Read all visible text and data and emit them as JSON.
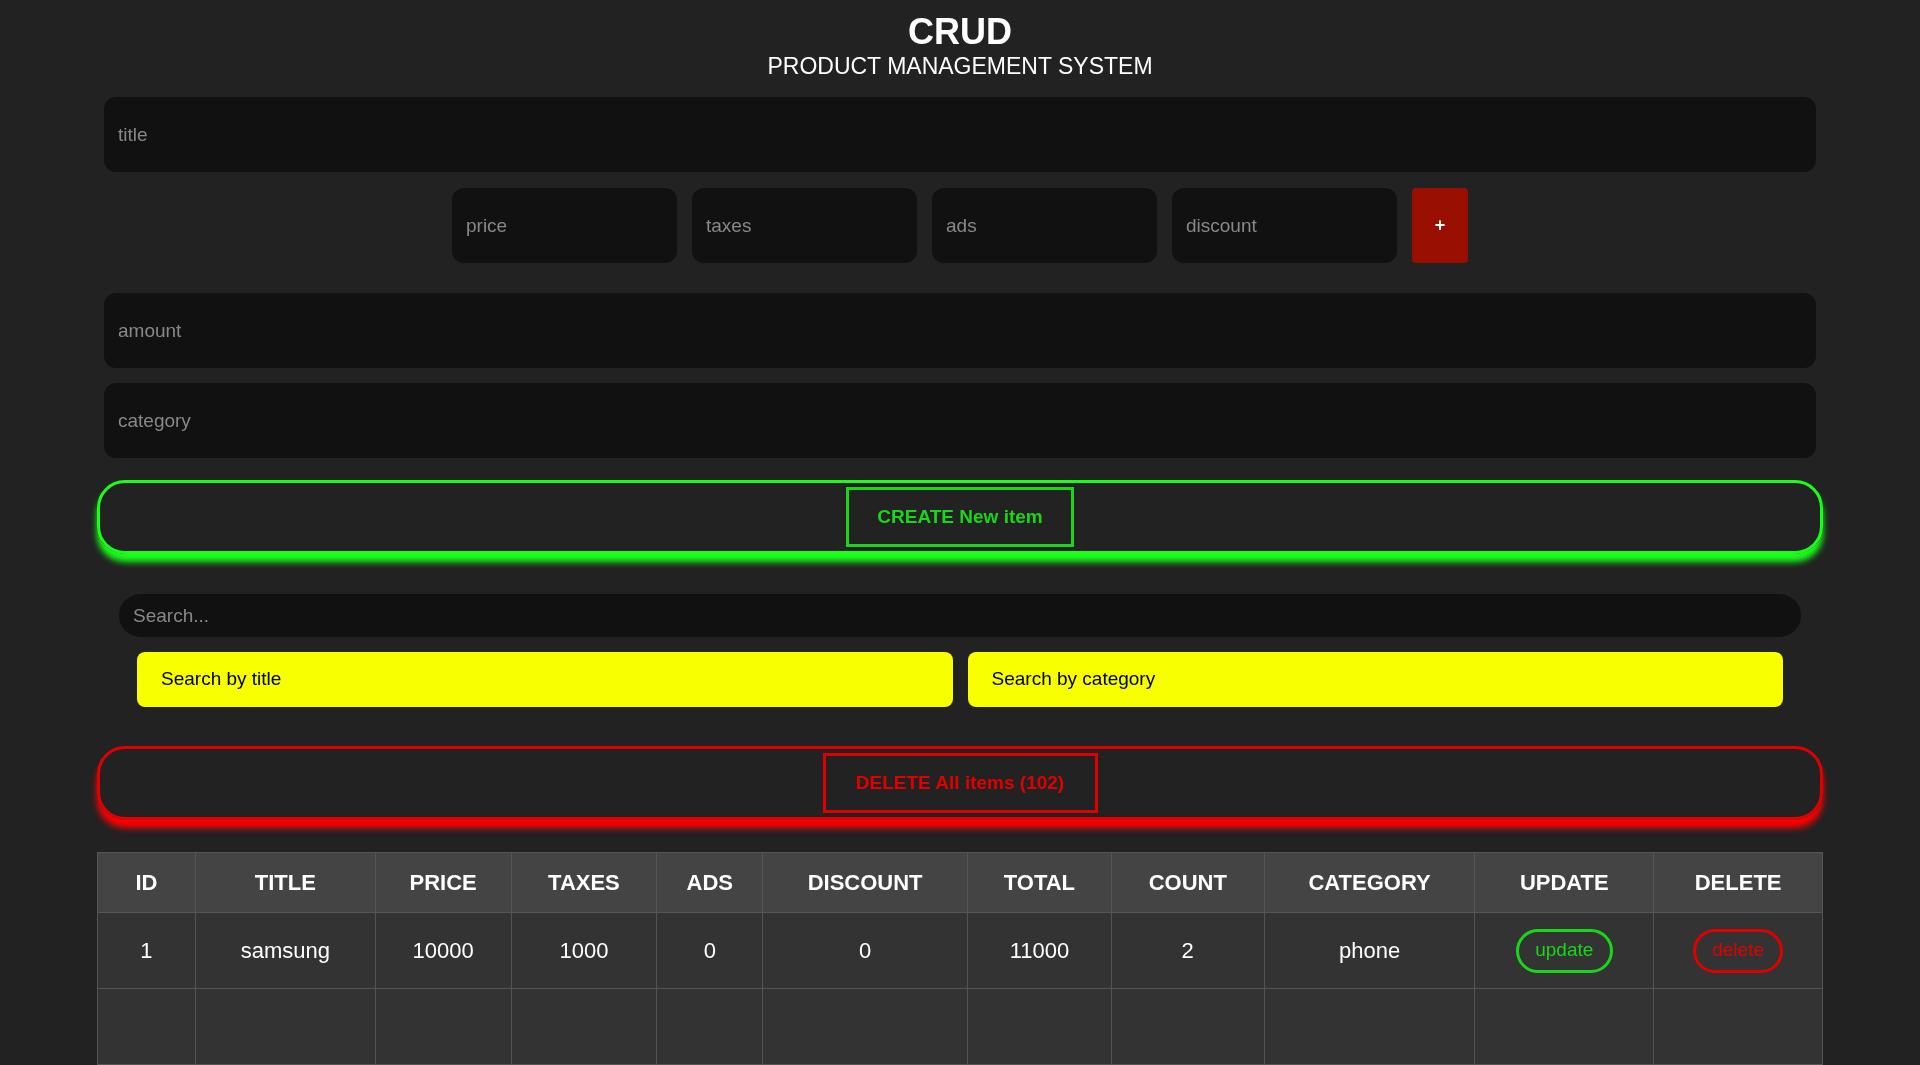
{
  "header": {
    "title": "CRUD",
    "subtitle": "PRODUCT MANAGEMENT SYSTEM"
  },
  "form": {
    "title": {
      "placeholder": "title"
    },
    "prices": [
      {
        "placeholder": "price"
      },
      {
        "placeholder": "taxes"
      },
      {
        "placeholder": "ads"
      },
      {
        "placeholder": "discount"
      }
    ],
    "total_button": "+",
    "amount": {
      "placeholder": "amount"
    },
    "category": {
      "placeholder": "category"
    },
    "create_button": "CREATE New item"
  },
  "search": {
    "placeholder": "Search...",
    "buttons": [
      "Search by title",
      "Search by category"
    ]
  },
  "delete_all_button": "DELETE All items (102)",
  "table": {
    "columns": [
      "ID",
      "TITLE",
      "PRICE",
      "TAXES",
      "ADS",
      "DISCOUNT",
      "TOTAL",
      "COUNT",
      "CATEGORY",
      "UPDATE",
      "DELETE"
    ],
    "rows": [
      {
        "cells": [
          "1",
          "samsung",
          "10000",
          "1000",
          "0",
          "0",
          "11000",
          "2",
          "phone"
        ],
        "update": "update",
        "delete": "delete"
      }
    ]
  }
}
